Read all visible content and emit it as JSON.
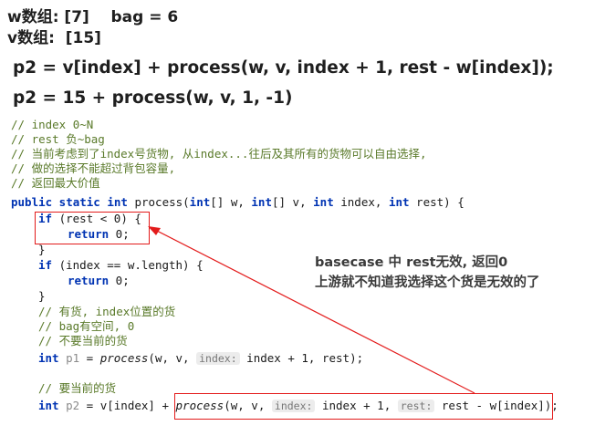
{
  "header": {
    "line1": "w数组: [7]    bag = 6",
    "line2": "v数组:  [15]",
    "formula1": "p2 = v[index] + process(w, v, index + 1, rest - w[index]);",
    "formula2": "p2 = 15 + process(w, v, 1, -1)"
  },
  "code": {
    "c1": "// index 0~N",
    "c2": "// rest 负~bag",
    "c3": "// 当前考虑到了index号货物, 从index...往后及其所有的货物可以自由选择,",
    "c4": "// 做的选择不能超过背包容量,",
    "c5": "// 返回最大价值",
    "sig_kw1": "public static int",
    "sig_mid": " process(",
    "sig_kw2": "int",
    "sig_w": "[] w, ",
    "sig_kw3": "int",
    "sig_v": "[] v, ",
    "sig_kw4": "int",
    "sig_index": " index, ",
    "sig_kw5": "int",
    "sig_end": " rest) {",
    "if1_kw": "if",
    "if1_rest": " (rest < 0) {",
    "ret1_kw": "return",
    "ret1_rest": " 0;",
    "brace1": "}",
    "if2_kw": "if",
    "if2_rest": " (index == w.length) {",
    "ret2_kw": "return",
    "ret2_rest": " 0;",
    "brace2": "}",
    "c6": "// 有货, index位置的货",
    "c7": "// bag有空间, 0",
    "c8": "// 不要当前的货",
    "p1_kw": "int",
    "p1_var": " p1",
    "p1_eq": " = ",
    "p1_fn": "process",
    "p1_args": "(w, v, ",
    "p1_hint": "index:",
    "p1_tail": " index + 1, rest);",
    "c9": "// 要当前的货",
    "p2_kw": "int",
    "p2_var": " p2",
    "p2_eq": " = v[index] + ",
    "p2_fn": "process",
    "p2_args": "(w, v, ",
    "p2_hint1": "index:",
    "p2_mid": " index + 1, ",
    "p2_hint2": "rest:",
    "p2_tail": " rest - w[index]);"
  },
  "annotation": {
    "line1": "basecase 中 rest无效, 返回0",
    "line2": "上游就不知道我选择这个货是无效的了"
  },
  "colors": {
    "highlight_red": "#e31b1b",
    "comment": "#5a7a2a",
    "keyword": "#0033b3"
  }
}
